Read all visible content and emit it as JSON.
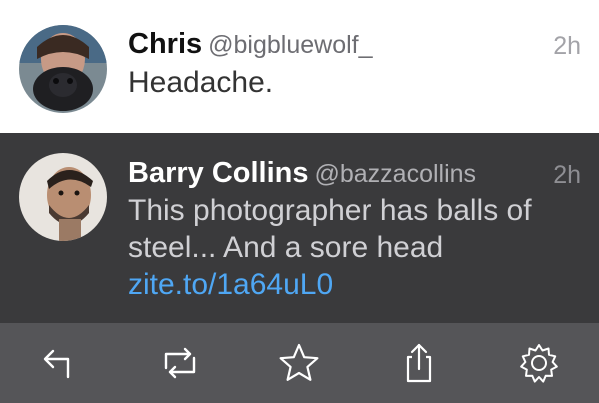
{
  "tweets": [
    {
      "name": "Chris",
      "handle": "@bigbluewolf_",
      "time": "2h",
      "text": "Headache.",
      "link": ""
    },
    {
      "name": "Barry Collins",
      "handle": "@bazzacollins",
      "time": "2h",
      "text": "This photographer has balls of steel... And a sore head ",
      "link": "zite.to/1a64uL0"
    }
  ],
  "toolbar": {
    "icons": [
      "reply-icon",
      "retweet-icon",
      "favorite-star-icon",
      "share-icon",
      "settings-gear-icon"
    ]
  },
  "colors": {
    "selected_background": "#3a3a3c",
    "toolbar_background": "#555558",
    "link": "#4fa7f4"
  }
}
